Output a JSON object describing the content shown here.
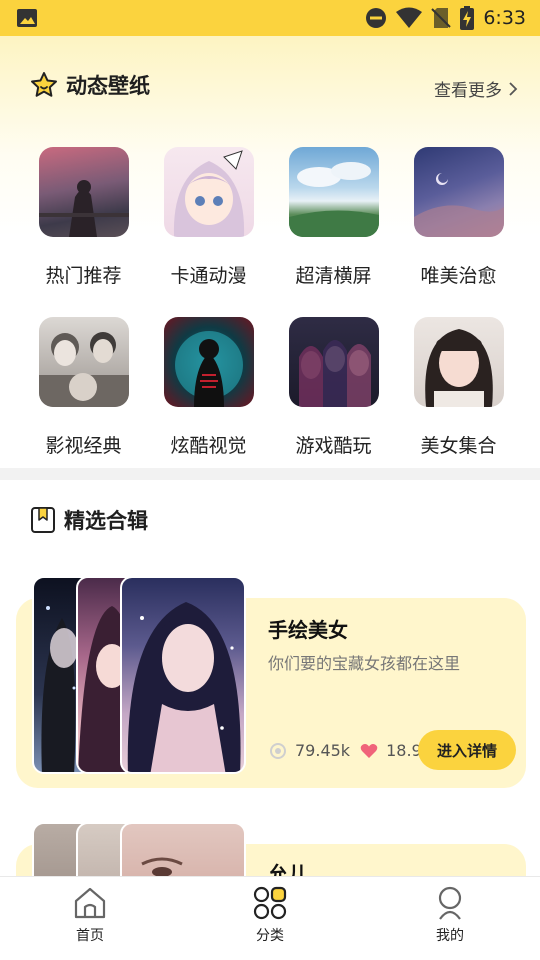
{
  "status_bar": {
    "time": "6:33",
    "icons": [
      "gallery-icon",
      "do-not-disturb-icon",
      "wifi-icon",
      "no-sim-icon",
      "battery-charging-icon"
    ]
  },
  "dynamic_wallpaper": {
    "title": "动态壁纸",
    "more_label": "查看更多",
    "categories": [
      {
        "label": "热门推荐"
      },
      {
        "label": "卡通动漫"
      },
      {
        "label": "超清横屏"
      },
      {
        "label": "唯美治愈"
      },
      {
        "label": "影视经典"
      },
      {
        "label": "炫酷视觉"
      },
      {
        "label": "游戏酷玩"
      },
      {
        "label": "美女集合"
      }
    ]
  },
  "featured": {
    "title": "精选合辑",
    "collections": [
      {
        "title": "手绘美女",
        "subtitle": "你们要的宝藏女孩都在这里",
        "views": "79.45k",
        "likes": "18.9",
        "button_label": "进入详情"
      },
      {
        "title": "允儿"
      }
    ]
  },
  "tab_bar": {
    "tabs": [
      {
        "label": "首页",
        "icon": "home-icon"
      },
      {
        "label": "分类",
        "icon": "category-icon"
      },
      {
        "label": "我的",
        "icon": "profile-icon"
      }
    ]
  },
  "colors": {
    "accent": "#fbd33e",
    "card_bg": "#fff6cc"
  }
}
